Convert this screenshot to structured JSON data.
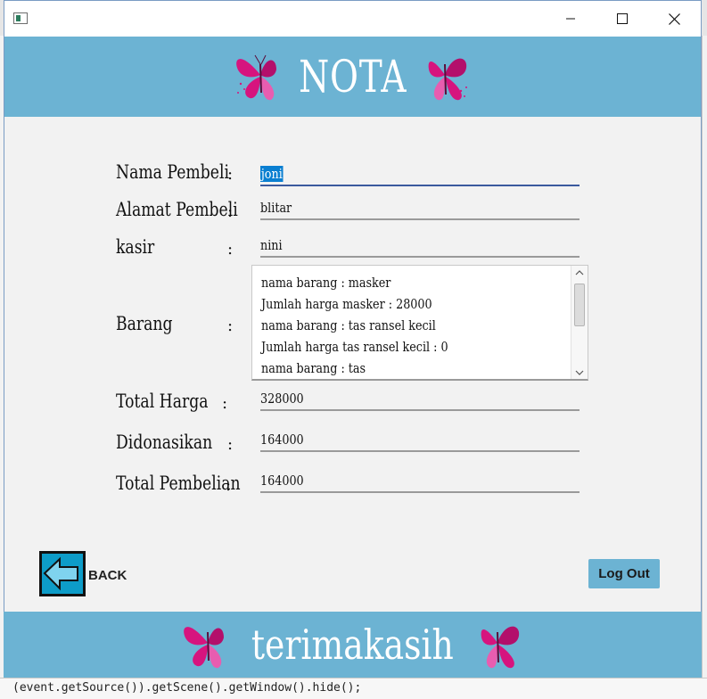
{
  "window": {
    "title": ""
  },
  "header": {
    "title": "NOTA"
  },
  "form": {
    "nama_pembeli": {
      "label": "Nama Pembeli",
      "colon": ":",
      "value": "joni"
    },
    "alamat_pembeli": {
      "label": "Alamat Pembeli",
      "colon": ":",
      "value": "blitar"
    },
    "kasir": {
      "label": "kasir",
      "colon": ":",
      "value": "nini"
    },
    "barang": {
      "label": "Barang",
      "colon": ":",
      "lines": [
        "nama barang : masker",
        "Jumlah harga masker : 28000",
        "nama barang : tas ransel kecil",
        "Jumlah harga tas ransel kecil : 0",
        "nama barang : tas"
      ]
    },
    "total_harga": {
      "label": "Total Harga",
      "colon": ":",
      "value": "328000"
    },
    "didonasikan": {
      "label": "Didonasikan",
      "colon": ":",
      "value": "164000"
    },
    "total_pembelian": {
      "label": "Total Pembelian",
      "colon": ":",
      "value": "164000"
    }
  },
  "buttons": {
    "back": "BACK",
    "logout": "Log Out"
  },
  "footer": {
    "text": "terimakasih"
  },
  "background": {
    "code_line": "(event.getSource()).getScene().getWindow().hide();"
  },
  "colors": {
    "banner": "#6cb3d3",
    "window_bg": "#f2f2f2",
    "back_button": "#0d9cc8",
    "butterfly": "#d6147e"
  },
  "icons": [
    "app-icon",
    "minimize-icon",
    "maximize-icon",
    "close-icon",
    "butterfly-icon",
    "back-arrow-icon",
    "scroll-up-icon",
    "scroll-down-icon"
  ]
}
